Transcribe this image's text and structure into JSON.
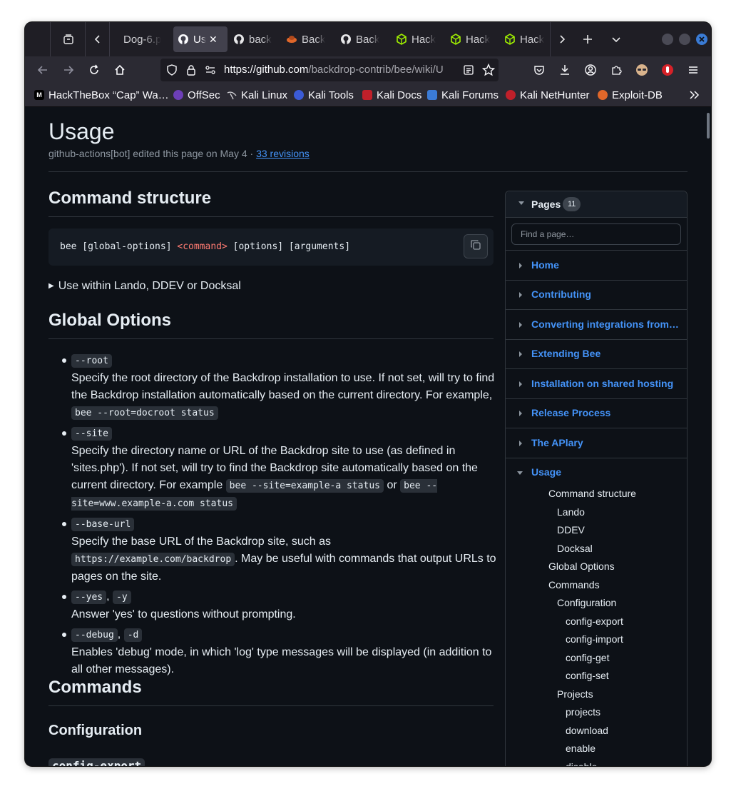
{
  "browser": {
    "tabs": [
      {
        "label": "Dog-6.p",
        "icon": "document-icon"
      },
      {
        "label": "Us",
        "icon": "github-icon",
        "active": true
      },
      {
        "label": "back",
        "icon": "github-icon"
      },
      {
        "label": "Back",
        "icon": "backdrop-icon"
      },
      {
        "label": "Back",
        "icon": "github-icon"
      },
      {
        "label": "Hack",
        "icon": "hackthebox-icon"
      },
      {
        "label": "Hack",
        "icon": "hackthebox-icon"
      },
      {
        "label": "Hack",
        "icon": "hackthebox-icon"
      }
    ],
    "url_main": "https://github.com",
    "url_rest": "/backdrop-contrib/bee/wiki/U",
    "bookmarks": [
      {
        "label": "HackTheBox “Cap” Wa…",
        "icon_text": "M",
        "color": "#000000"
      },
      {
        "label": "OffSec",
        "icon_text": "",
        "color": "#6d3fb8"
      },
      {
        "label": "Kali Linux",
        "icon_text": "",
        "color": "#2b2a33"
      },
      {
        "label": "Kali Tools",
        "icon_text": "",
        "color": "#3b5bd6"
      },
      {
        "label": "Kali Docs",
        "icon_text": "",
        "color": "#c0202a"
      },
      {
        "label": "Kali Forums",
        "icon_text": "",
        "color": "#3b7bd6"
      },
      {
        "label": "Kali NetHunter",
        "icon_text": "",
        "color": "#c0202a"
      },
      {
        "label": "Exploit-DB",
        "icon_text": "",
        "color": "#e0672a"
      }
    ]
  },
  "page": {
    "title": "Usage",
    "meta_text": "github-actions[bot] edited this page on May 4 · ",
    "revisions_link": "33 revisions",
    "h_command_structure": "Command structure",
    "code_pre": "bee [global-options] ",
    "code_kw": "<command>",
    "code_post": " [options] [arguments]",
    "details_summary": "Use within Lando, DDEV or Docksal",
    "h_global_options": "Global Options",
    "opt_root_code": "--root",
    "opt_root_text": "Specify the root directory of the Backdrop installation to use. If not set, will try to find the Backdrop installation automatically based on the current directory. For example,",
    "opt_root_example": "bee --root=docroot status",
    "opt_site_code": "--site",
    "opt_site_text": "Specify the directory name or URL of the Backdrop site to use (as defined in 'sites.php'). If not set, will try to find the Backdrop site automatically based on the current directory. For example",
    "opt_site_ex1": "bee --site=example-a status",
    "opt_site_or": "or",
    "opt_site_ex2": "bee --site=www.example-a.com status",
    "opt_baseurl_code": "--base-url",
    "opt_baseurl_text1": "Specify the base URL of the Backdrop site, such as",
    "opt_baseurl_ex": "https://example.com/backdrop",
    "opt_baseurl_text2": ". May be useful with commands that output URLs to pages on the site.",
    "opt_yes_code1": "--yes",
    "opt_yes_code2": "-y",
    "opt_yes_text": "Answer 'yes' to questions without prompting.",
    "opt_debug_code1": "--debug",
    "opt_debug_code2": "-d",
    "opt_debug_text": "Enables 'debug' mode, in which 'log' type messages will be displayed (in addition to all other messages).",
    "comma": ",",
    "h_commands": "Commands",
    "h_configuration": "Configuration",
    "h_config_export": "config-export"
  },
  "sidebar": {
    "title": "Pages",
    "count": "11",
    "search_placeholder": "Find a page…",
    "pages": [
      "Home",
      "Contributing",
      "Converting integrations from…",
      "Extending Bee",
      "Installation on shared hosting",
      "Release Process",
      "The APlary",
      "Usage"
    ],
    "toc": [
      "Command structure",
      "Lando",
      "DDEV",
      "Docksal",
      "Global Options",
      "Commands",
      "Configuration",
      "config-export",
      "config-import",
      "config-get",
      "config-set",
      "Projects",
      "projects",
      "download",
      "enable",
      "disable"
    ]
  }
}
